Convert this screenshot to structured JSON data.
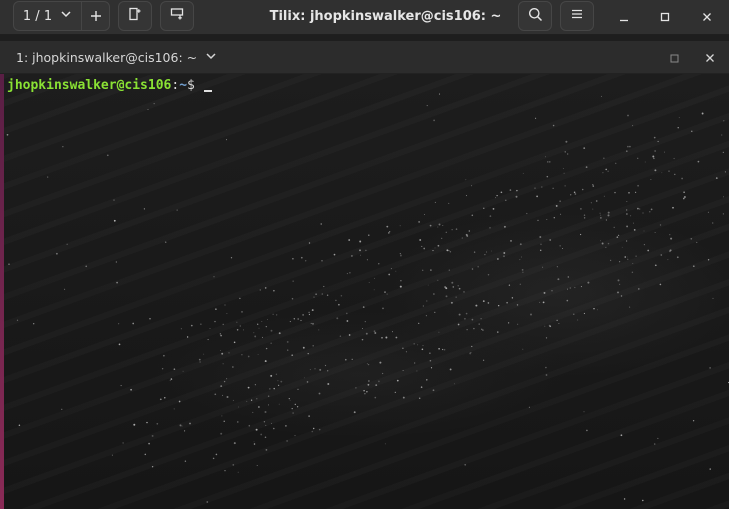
{
  "header": {
    "session_counter": "1 / 1",
    "window_title": "Tilix: jhopkinswalker@cis106: ~",
    "icons": {
      "session_dropdown": "chevron-down-icon",
      "add_session": "plus-icon",
      "split_right": "split-right-icon",
      "split_down": "split-down-icon",
      "search": "search-icon",
      "menu": "hamburger-menu-icon",
      "minimize": "minimize-icon",
      "maximize": "maximize-icon",
      "close": "close-icon"
    }
  },
  "terminal_tab": {
    "title": "1: jhopkinswalker@cis106: ~",
    "icons": {
      "dropdown": "chevron-down-icon",
      "maximize": "maximize-terminal-icon",
      "close": "close-icon"
    }
  },
  "terminal": {
    "prompt_user_host": "jhopkinswalker@cis106",
    "prompt_separator": ":",
    "prompt_path": "~",
    "prompt_symbol": "$",
    "input_text": ""
  },
  "colors": {
    "headerbar_bg": "#303030",
    "prompt_user": "#8ae234",
    "prompt_path": "#729fcf",
    "terminal_bg": "#1a1a1a"
  }
}
